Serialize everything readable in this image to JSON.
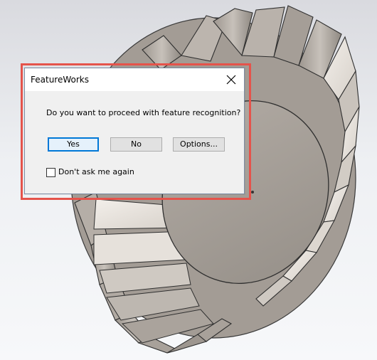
{
  "dialog": {
    "title": "FeatureWorks",
    "message": "Do you want to proceed with feature recognition?",
    "buttons": {
      "yes": "Yes",
      "no": "No",
      "options": "Options..."
    },
    "checkbox": {
      "label": "Don't ask me again",
      "checked": false
    },
    "close_icon": "close-icon"
  },
  "colors": {
    "highlight": "#e5534b",
    "dialog_bg": "#f0f0f0",
    "default_button_border": "#0078d7"
  }
}
